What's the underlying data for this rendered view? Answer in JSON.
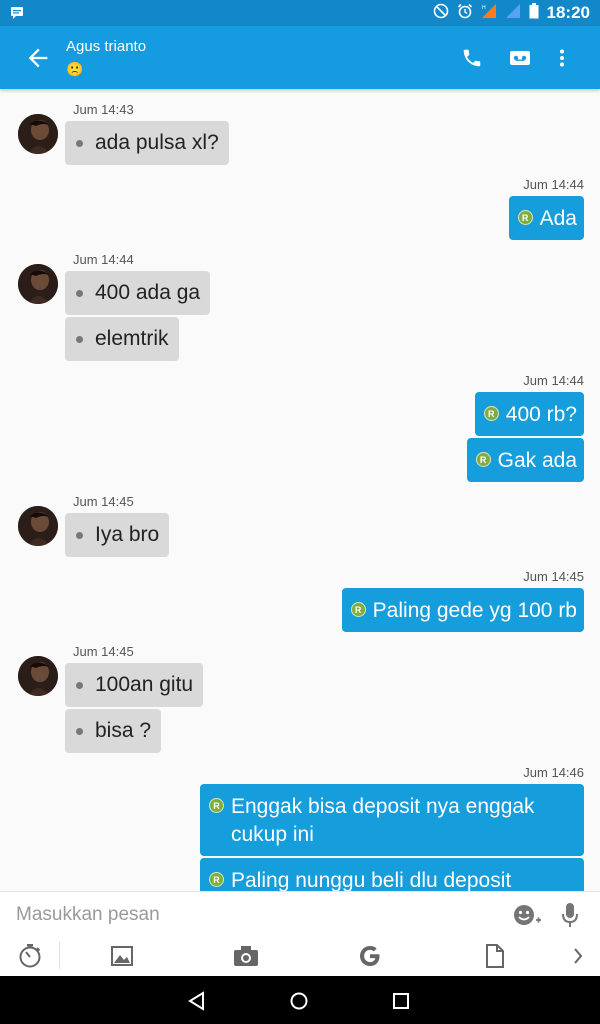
{
  "status_bar": {
    "time": "18:20",
    "notification_icon": "message-notification-icon",
    "icons": [
      "do-not-disturb-icon",
      "alarm-icon",
      "mobile-data-icon",
      "signal-icon",
      "battery-icon"
    ]
  },
  "header": {
    "contact_name": "Agus trianto",
    "status_emoji": "🙁",
    "actions": [
      "phone-icon",
      "voicemail-icon",
      "more-vert-icon"
    ]
  },
  "messages": [
    {
      "direction": "in",
      "time": "Jum 14:43",
      "texts": [
        "ada pulsa xl?"
      ]
    },
    {
      "direction": "out",
      "time": "Jum 14:44",
      "texts": [
        "Ada"
      ]
    },
    {
      "direction": "in",
      "time": "Jum 14:44",
      "texts": [
        "400 ada ga",
        "elemtrik"
      ]
    },
    {
      "direction": "out",
      "time": "Jum 14:44",
      "texts": [
        "400 rb?",
        "Gak ada"
      ]
    },
    {
      "direction": "in",
      "time": "Jum 14:45",
      "texts": [
        "Iya bro"
      ]
    },
    {
      "direction": "out",
      "time": "Jum 14:45",
      "texts": [
        "Paling gede yg 100 rb"
      ]
    },
    {
      "direction": "in",
      "time": "Jum 14:45",
      "texts": [
        "100an gitu",
        "bisa ?"
      ]
    },
    {
      "direction": "out",
      "time": "Jum 14:46",
      "texts": [
        "Enggak bisa deposit nya enggak cukup ini",
        "Paling nunggu beli dlu deposit"
      ]
    }
  ],
  "sent_badge": "R",
  "composer": {
    "placeholder": "Masukkan pesan",
    "toolbar": [
      "timer-icon",
      "image-icon",
      "camera-icon",
      "google-icon",
      "file-icon",
      "chevron-right-icon"
    ]
  },
  "colors": {
    "status_bar": "#1288c8",
    "app_bar": "#159ce0",
    "outgoing_bubble": "#169ddb",
    "incoming_bubble": "#d9d9d9"
  }
}
